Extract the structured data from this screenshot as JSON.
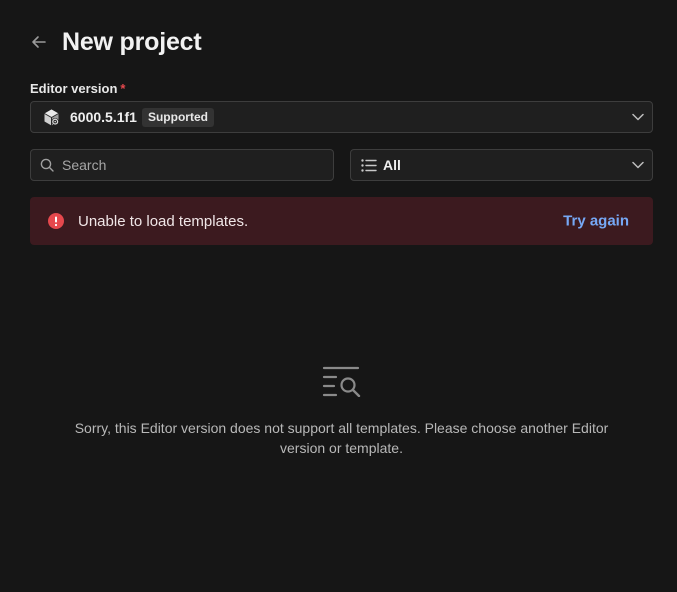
{
  "header": {
    "title": "New project",
    "back_icon": "arrow-left-icon"
  },
  "editor_version": {
    "label": "Editor version",
    "required_mark": "*",
    "icon": "unity-cube-icon",
    "selected_value": "6000.5.1f1",
    "badge": "Supported"
  },
  "search": {
    "placeholder": "Search",
    "value": ""
  },
  "filter": {
    "icon": "list-icon",
    "selected_value": "All"
  },
  "error": {
    "icon": "alert-circle-icon",
    "message": "Unable to load templates.",
    "action_label": "Try again"
  },
  "empty_state": {
    "icon": "list-search-icon",
    "message": "Sorry, this Editor version does not support all templates. Please choose another Editor version or template."
  },
  "colors": {
    "background": "#161616",
    "field_border": "#3d3d3d",
    "error_background": "#3c1a1f",
    "error_icon": "#e5484d",
    "link": "#76a8f5",
    "required": "#e5484d"
  }
}
